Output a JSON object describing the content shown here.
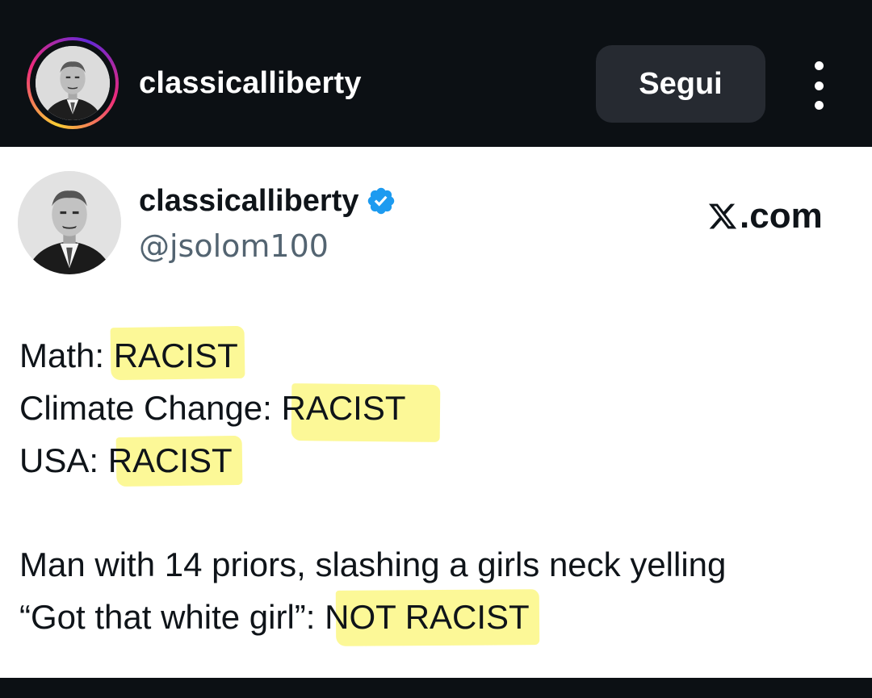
{
  "instagram": {
    "username": "classicalliberty",
    "follow_label": "Segui",
    "more_icon": "more-vertical-icon"
  },
  "tweet": {
    "display_name": "classicalliberty",
    "handle": "@jsolom100",
    "verified": true,
    "source": ".com",
    "source_brand": "X",
    "lines": [
      {
        "prefix": "Math: ",
        "highlight": "RACIST"
      },
      {
        "prefix": "Climate Change: ",
        "highlight": "RACIST"
      },
      {
        "prefix": "USA: ",
        "highlight": "RACIST"
      }
    ],
    "line4": "Man with 14 priors, slashing a girls neck  yelling",
    "line5_prefix": "“Got that white girl”: ",
    "line5_highlight": "NOT RACIST"
  },
  "colors": {
    "background_dark": "#0c1014",
    "follow_button": "#262a31",
    "highlight": "#fcf891",
    "verified_blue": "#1d9bf0",
    "handle_gray": "#536471"
  }
}
